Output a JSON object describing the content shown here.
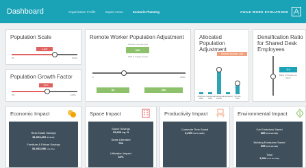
{
  "header": {
    "title": "Dashboard",
    "tabs": [
      {
        "label": "Organization Profile",
        "active": false
      },
      {
        "label": "Impact Areas",
        "active": false
      },
      {
        "label": "Scenario Planning",
        "active": true
      }
    ],
    "brand": "AGILE WORK EVOLUTIONS",
    "colors": {
      "bar": "#1aa2b7"
    }
  },
  "population_scale": {
    "title": "Population Scale",
    "value": "1,200",
    "min": "25",
    "max": "5,000"
  },
  "growth_factor": {
    "title": "Population Growth Factor",
    "value": "10%",
    "min": "0%",
    "max": "100%"
  },
  "remote_worker": {
    "title": "Remote Worker Population Adjustment",
    "note_top": "Number of employees",
    "value": "356",
    "note_mid": "30% in 3 days remote",
    "min": "0",
    "max": "100%",
    "left_box": "52",
    "right_box": "356"
  },
  "allocated": {
    "title": "Allocated Population Adjustment",
    "pill": "Remote Worker: 356",
    "categories": [
      "Assigned office",
      "Unassigned office",
      "Unassigned cubicle",
      "Unassigned",
      "Remote work"
    ]
  },
  "densification": {
    "title": "Densification Ratio for Shared Desk Employees",
    "value": "1:1",
    "note": "Ratio of People per Desk"
  },
  "economic": {
    "title": "Economic Impact",
    "icon": "coins-icon",
    "line1": "Real Estate Savings",
    "value1": "$1,003,402",
    "unit1": "annually",
    "line2": "Furniture & Fixture Savings",
    "value2": "$1,933,696",
    "unit2": "one-time"
  },
  "space": {
    "title": "Space Impact",
    "icon": "building-icon",
    "line1": "Space Savings",
    "value1": "35,629 sq. ft",
    "line2": "Seats Liberated",
    "value2": "756",
    "line3": "Utilization Impact",
    "value3": "62%"
  },
  "productivity": {
    "title": "Productivity Impact",
    "icon": "desk-icon",
    "line1": "Commute Time Saved",
    "value1": "2,209",
    "unit1": "hours weekly"
  },
  "environmental": {
    "title": "Environmental Impact",
    "icon": "leaf-icon",
    "line1": "Car Emissions Saved",
    "value1": "689",
    "unit1": "tons annually",
    "line2": "Building Emissions Saved",
    "value2": "395",
    "unit2": "tons annually",
    "line3": "Total",
    "value3": "1,084",
    "unit3": "tons annually"
  }
}
